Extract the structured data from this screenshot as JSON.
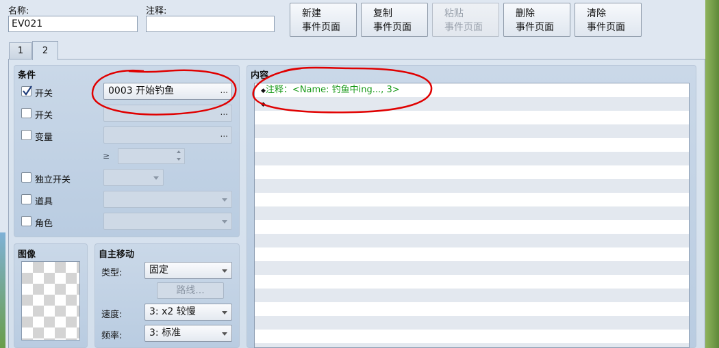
{
  "header": {
    "name_label": "名称:",
    "name_value": "EV021",
    "note_label": "注释:",
    "note_value": ""
  },
  "toolbar": {
    "buttons": [
      {
        "line1": "新建",
        "line2": "事件页面",
        "enabled": true
      },
      {
        "line1": "复制",
        "line2": "事件页面",
        "enabled": true
      },
      {
        "line1": "粘贴",
        "line2": "事件页面",
        "enabled": false
      },
      {
        "line1": "删除",
        "line2": "事件页面",
        "enabled": true
      },
      {
        "line1": "清除",
        "line2": "事件页面",
        "enabled": true
      }
    ]
  },
  "tabs": [
    {
      "label": "1",
      "active": false
    },
    {
      "label": "2",
      "active": true
    }
  ],
  "conditions": {
    "title": "条件",
    "switch1": {
      "label": "开关",
      "checked": true,
      "value": "0003 开始钓鱼",
      "button": "..."
    },
    "switch2": {
      "label": "开关",
      "checked": false,
      "value": "",
      "button": "..."
    },
    "variable": {
      "label": "变量",
      "checked": false,
      "value": "",
      "button": "...",
      "operator": "≥"
    },
    "self_switch": {
      "label": "独立开关",
      "checked": false
    },
    "item": {
      "label": "道具",
      "checked": false
    },
    "actor": {
      "label": "角色",
      "checked": false
    }
  },
  "image": {
    "title": "图像"
  },
  "autonomous": {
    "title": "自主移动",
    "type_label": "类型:",
    "type_value": "固定",
    "route_button": "路线...",
    "speed_label": "速度:",
    "speed_value": "3: x2 较慢",
    "freq_label": "频率:",
    "freq_value": "3: 标准"
  },
  "contents": {
    "title": "内容",
    "lines": [
      {
        "marker": "◆",
        "text": "注释：<Name: 钓鱼中ing..., 3>",
        "color": "#1a9a1a"
      },
      {
        "marker": "◆",
        "text": "",
        "color": "#111111"
      }
    ]
  },
  "colors": {
    "annotation": "#e00000",
    "comment_text": "#1a9a1a"
  }
}
